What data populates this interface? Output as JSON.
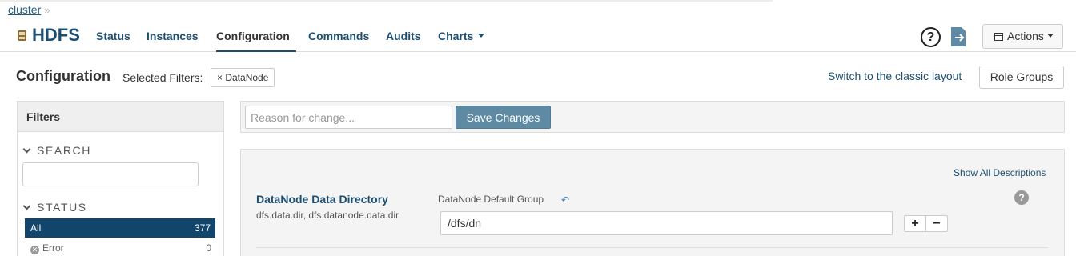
{
  "breadcrumb": {
    "cluster": "cluster",
    "separator": "»"
  },
  "header": {
    "service_name": "HDFS",
    "tabs": [
      {
        "label": "Status",
        "active": false
      },
      {
        "label": "Instances",
        "active": false
      },
      {
        "label": "Configuration",
        "active": true
      },
      {
        "label": "Commands",
        "active": false
      },
      {
        "label": "Audits",
        "active": false
      },
      {
        "label": "Charts",
        "active": false
      }
    ],
    "help_label": "?",
    "actions_label": "Actions"
  },
  "config": {
    "title": "Configuration",
    "selected_filters_label": "Selected Filters:",
    "filter_chip": "× DataNode",
    "switch_link": "Switch to the classic layout",
    "role_groups_label": "Role Groups"
  },
  "filters": {
    "title": "Filters",
    "search_label": "SEARCH",
    "status_label": "STATUS",
    "status_items": [
      {
        "label": "All",
        "count": "377"
      },
      {
        "label": "Error",
        "count": "0"
      }
    ]
  },
  "reason_bar": {
    "placeholder": "Reason for change...",
    "save_label": "Save Changes"
  },
  "property": {
    "show_all_descriptions": "Show All Descriptions",
    "title": "DataNode Data Directory",
    "keys": "dfs.data.dir, dfs.datanode.data.dir",
    "group": "DataNode Default Group",
    "undo_glyph": "↶",
    "value": "/dfs/dn",
    "plus": "+",
    "minus": "−",
    "help": "?"
  },
  "colors": {
    "brand_dark": "#1d4f72",
    "selected_row": "#11456c",
    "save_button": "#5e8aa4"
  }
}
